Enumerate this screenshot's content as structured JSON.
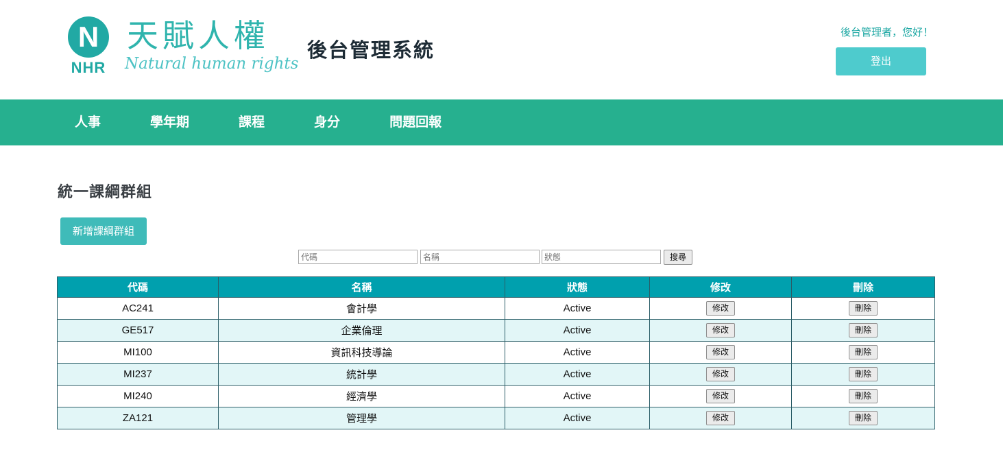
{
  "header": {
    "logo_letter": "N",
    "logo_abbr": "NHR",
    "logo_cn": "天賦人權",
    "logo_en": "Natural human rights",
    "system_title": "後台管理系統",
    "greeting": "後台管理者，您好！",
    "logout_label": "登出"
  },
  "nav": {
    "items": [
      {
        "label": "人事"
      },
      {
        "label": "學年期"
      },
      {
        "label": "課程"
      },
      {
        "label": "身分"
      },
      {
        "label": "問題回報"
      }
    ]
  },
  "main": {
    "title": "統一課綱群組",
    "add_label": "新增課綱群組",
    "search": {
      "code_placeholder": "代碼",
      "name_placeholder": "名稱",
      "status_placeholder": "狀態",
      "button_label": "搜尋"
    },
    "table": {
      "columns": [
        "代碼",
        "名稱",
        "狀態",
        "修改",
        "刪除"
      ],
      "edit_label": "修改",
      "delete_label": "刪除",
      "rows": [
        {
          "code": "AC241",
          "name": "會計學",
          "status": "Active"
        },
        {
          "code": "GE517",
          "name": "企業倫理",
          "status": "Active"
        },
        {
          "code": "MI100",
          "name": "資訊科技導論",
          "status": "Active"
        },
        {
          "code": "MI237",
          "name": "統計學",
          "status": "Active"
        },
        {
          "code": "MI240",
          "name": "經濟學",
          "status": "Active"
        },
        {
          "code": "ZA121",
          "name": "管理學",
          "status": "Active"
        }
      ]
    }
  },
  "colors": {
    "nav_bg": "#26b08f",
    "table_header": "#00a0ae",
    "alt_row": "#e2f6f7",
    "button_teal": "#3fbbb9",
    "logo_teal": "#21a9a4"
  }
}
